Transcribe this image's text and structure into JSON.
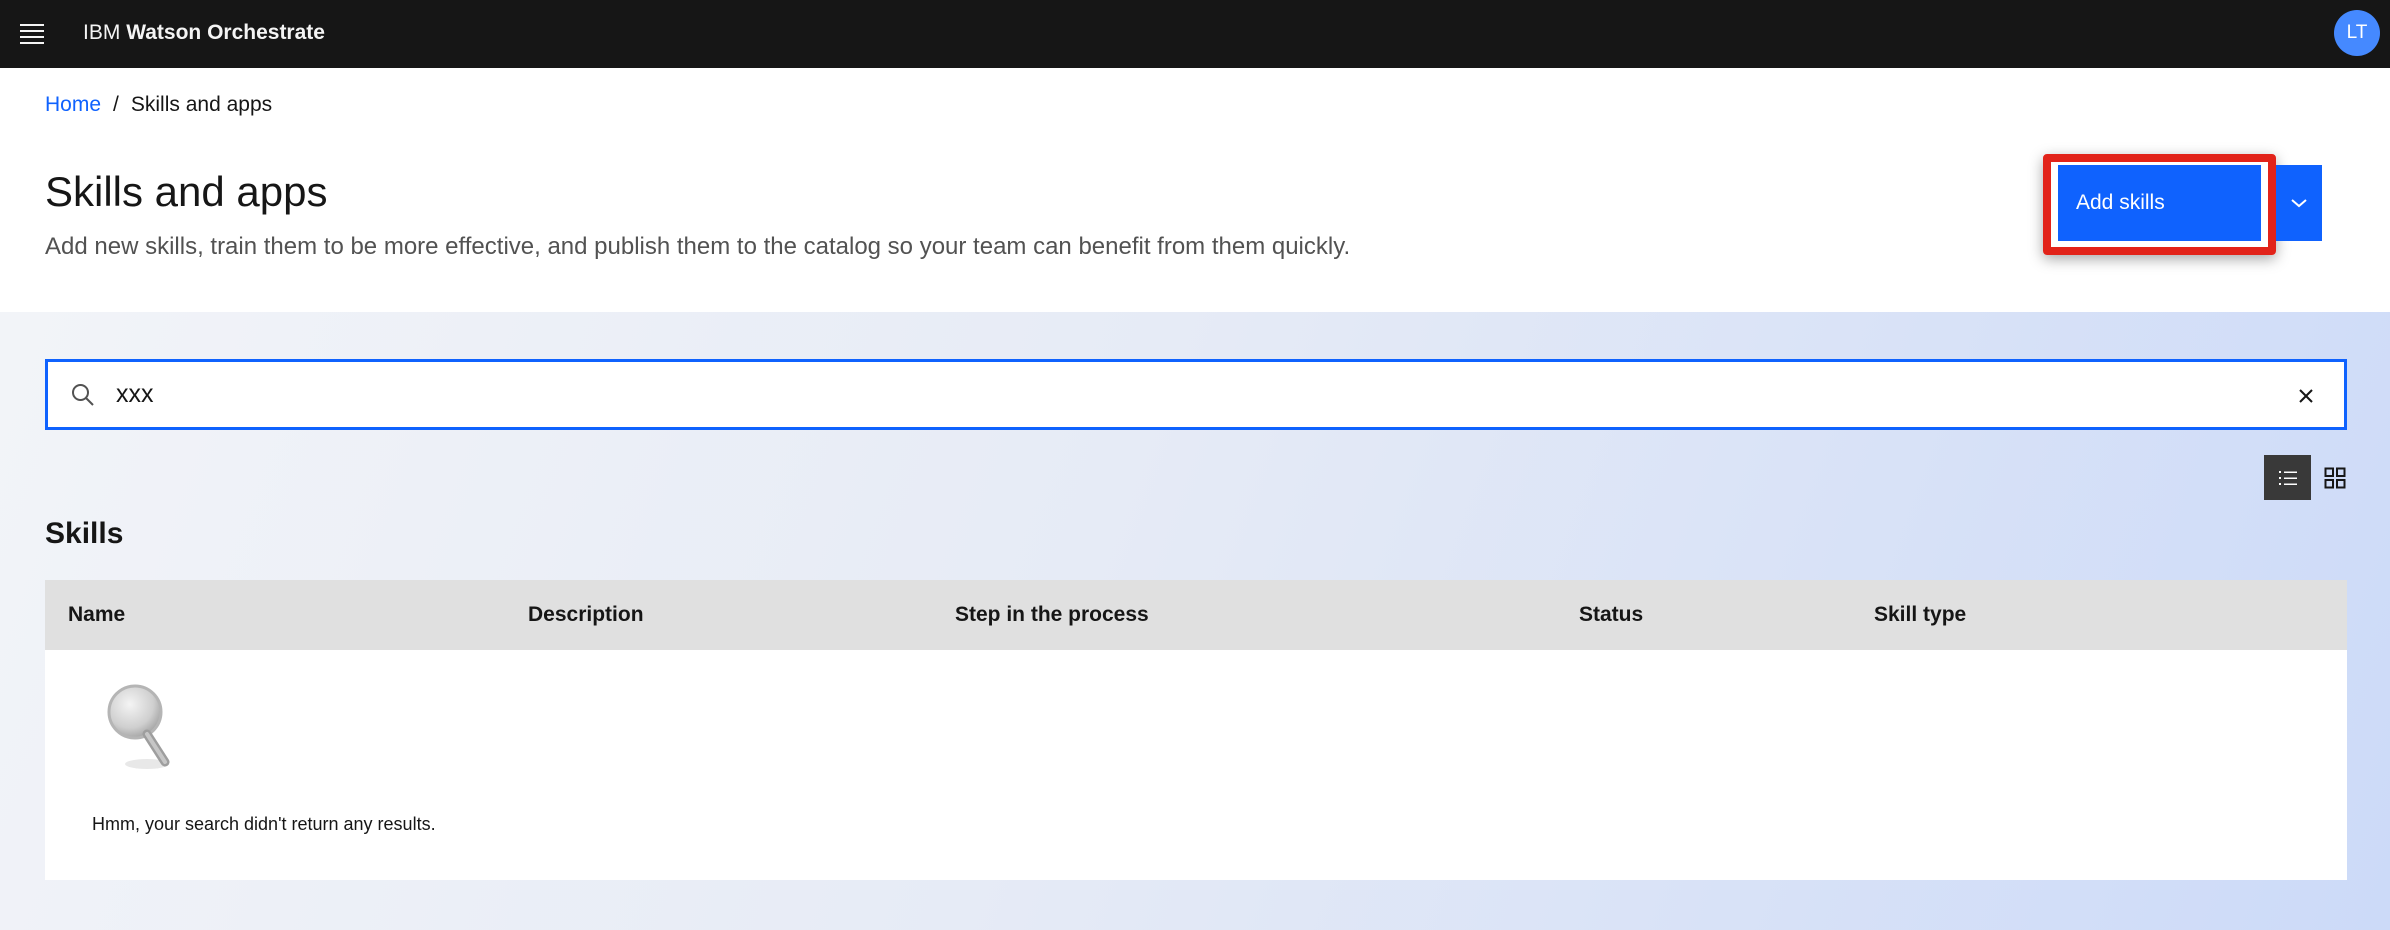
{
  "header": {
    "brand_prefix": "IBM",
    "brand_name": "Watson Orchestrate",
    "avatar_initials": "LT",
    "icons": {
      "menu": "hamburger-menu-icon"
    }
  },
  "breadcrumb": {
    "home": "Home",
    "separator": "/",
    "current": "Skills and apps"
  },
  "page": {
    "title": "Skills and apps",
    "subtitle": "Add new skills, train them to be more effective, and publish them to the catalog so your team can benefit from them quickly.",
    "add_skills_label": "Add skills",
    "add_skills_menu_icon": "chevron-down-icon",
    "highlight_color": "#e2231a"
  },
  "search": {
    "value": "xxx",
    "icon": "search-icon",
    "clear_icon": "close-icon"
  },
  "view_toggle": {
    "selected": "list",
    "list_icon": "list-view-icon",
    "grid_icon": "grid-view-icon"
  },
  "skills": {
    "section_title": "Skills",
    "columns": [
      "Name",
      "Description",
      "Step in the process",
      "Status",
      "Skill type"
    ],
    "rows": [],
    "empty_icon": "magnifying-glass-icon",
    "empty_message": "Hmm, your search didn't return any results."
  },
  "colors": {
    "topbar": "#161616",
    "accent": "#0f62fe",
    "avatar": "#4589ff",
    "table_header": "#e0e0e0"
  }
}
